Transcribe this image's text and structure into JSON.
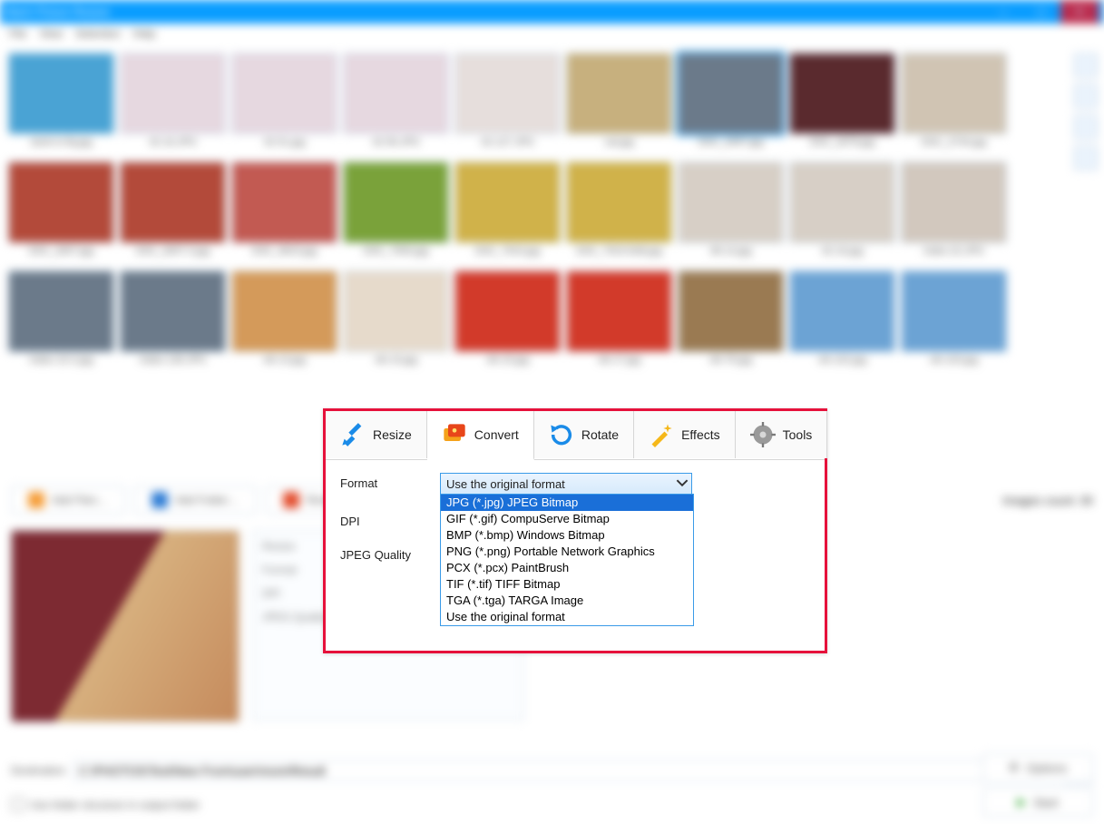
{
  "window": {
    "title": "Batch Picture Resizer",
    "minimize": "—",
    "maximize": "▢",
    "close": "✕"
  },
  "menu": {
    "items": [
      "File",
      "View",
      "Selection",
      "Help"
    ]
  },
  "gallery": {
    "thumbs": [
      {
        "cap": "stork-in-fly.jpg",
        "bg": "#4aa3d4"
      },
      {
        "cap": "42-16.JPG",
        "bg": "#e6d8e0"
      },
      {
        "cap": "42-51.jpg",
        "bg": "#e6d8e0"
      },
      {
        "cap": "42-56.JPG",
        "bg": "#e6d8e0"
      },
      {
        "cap": "42-127.JPG",
        "bg": "#e6dedc"
      },
      {
        "cap": "cat.jpg",
        "bg": "#c7b07e"
      },
      {
        "cap": "DSC_2097.jpg",
        "bg": "#6b7a8a",
        "sel": true
      },
      {
        "cap": "DSC_2678.jpg",
        "bg": "#5a2a2e"
      },
      {
        "cap": "DSC_2734.jpg",
        "bg": "#d0c4b3"
      },
      {
        "cap": "DSC_2607.jpg",
        "bg": "#b34a3a"
      },
      {
        "cap": "DSC_2607-2.jpg",
        "bg": "#b34a3a"
      },
      {
        "cap": "DSC_9623.jpg",
        "bg": "#c25a52"
      },
      {
        "cap": "DSC_7930.jpg",
        "bg": "#7aa23a"
      },
      {
        "cap": "DSC_7915.jpg",
        "bg": "#d0b24a"
      },
      {
        "cap": "DSC_7915-Edit.jpg",
        "bg": "#d0b24a"
      },
      {
        "cap": "48-14.jpg",
        "bg": "#d7cfc6"
      },
      {
        "cap": "42-16.jpg",
        "bg": "#d7cfc6"
      },
      {
        "cap": "index-22.JPG",
        "bg": "#d2c8be"
      },
      {
        "cap": "Index-10-2.jpg",
        "bg": "#6b7a8a"
      },
      {
        "cap": "Index-136.JPG",
        "bg": "#6b7a8a"
      },
      {
        "cap": "vik-13.jpg",
        "bg": "#d49a5a"
      },
      {
        "cap": "vik-15.jpg",
        "bg": "#e6dacb"
      },
      {
        "cap": "vik-15.jpg",
        "bg": "#d23a2a"
      },
      {
        "cap": "vik-17.jpg",
        "bg": "#d23a2a"
      },
      {
        "cap": "vik-76.jpg",
        "bg": "#9a7a52"
      },
      {
        "cap": "vik-102.jpg",
        "bg": "#6ca3d4"
      },
      {
        "cap": "vik-103.jpg",
        "bg": "#6ca3d4"
      }
    ],
    "count_label": "Images count: 30"
  },
  "buttons": {
    "add_files": "Add Files…",
    "add_folder": "Add Folder…",
    "remove": "Remove"
  },
  "panel_blur": {
    "row1": "Resize",
    "row2": "Format",
    "row3": "DPI",
    "row4": "JPEG Quality"
  },
  "dest": {
    "label": "Destination",
    "value": "C:\\PHOTOS\\Test\\New From\\user\\more\\Result",
    "checkbox": "Use folder structure in output folder",
    "options_btn": "Options",
    "start_btn": "Start"
  },
  "tabs": {
    "resize": "Resize",
    "convert": "Convert",
    "rotate": "Rotate",
    "effects": "Effects",
    "tools": "Tools"
  },
  "convert": {
    "format_label": "Format",
    "dpi_label": "DPI",
    "quality_label": "JPEG Quality",
    "selected": "Use the original format",
    "options": [
      "JPG (*.jpg) JPEG Bitmap",
      "GIF (*.gif) CompuServe Bitmap",
      "BMP (*.bmp) Windows Bitmap",
      "PNG (*.png) Portable Network Graphics",
      "PCX (*.pcx) PaintBrush",
      "TIF (*.tif) TIFF Bitmap",
      "TGA (*.tga) TARGA Image",
      "Use the original format"
    ],
    "highlight": 0
  }
}
